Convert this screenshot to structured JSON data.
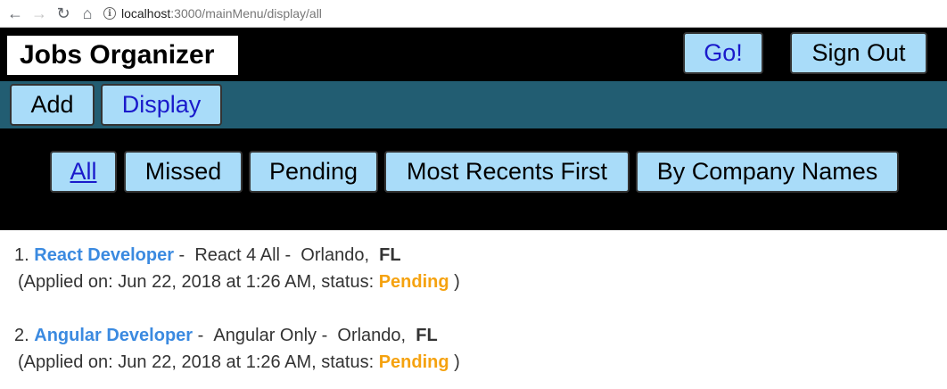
{
  "browser": {
    "url_host": "localhost",
    "url_path": ":3000/mainMenu/display/all"
  },
  "header": {
    "brand": "Jobs Organizer",
    "go_label": "Go!",
    "signout_label": "Sign Out"
  },
  "menu": {
    "add_label": "Add",
    "display_label": "Display"
  },
  "filters": {
    "all": "All",
    "missed": "Missed",
    "pending": "Pending",
    "recent": "Most Recents First",
    "company": "By Company Names"
  },
  "jobs": [
    {
      "index": "1.",
      "title": "React Developer",
      "company": "React 4 All",
      "city": "Orlando,",
      "state": "FL",
      "applied_prefix": "(Applied on: Jun 22, 2018 at 1:26 AM, status:",
      "status": "Pending",
      "applied_suffix": ")"
    },
    {
      "index": "2.",
      "title": "Angular Developer",
      "company": "Angular Only",
      "city": "Orlando,",
      "state": "FL",
      "applied_prefix": "(Applied on: Jun 22, 2018 at 1:26 AM, status:",
      "status": "Pending",
      "applied_suffix": ")"
    }
  ],
  "colors": {
    "header_bg": "#000000",
    "menu_bg": "#225d72",
    "button_bg": "#a9dcf9",
    "link_blue": "#3b8ae0",
    "status_orange": "#f5a20f"
  }
}
